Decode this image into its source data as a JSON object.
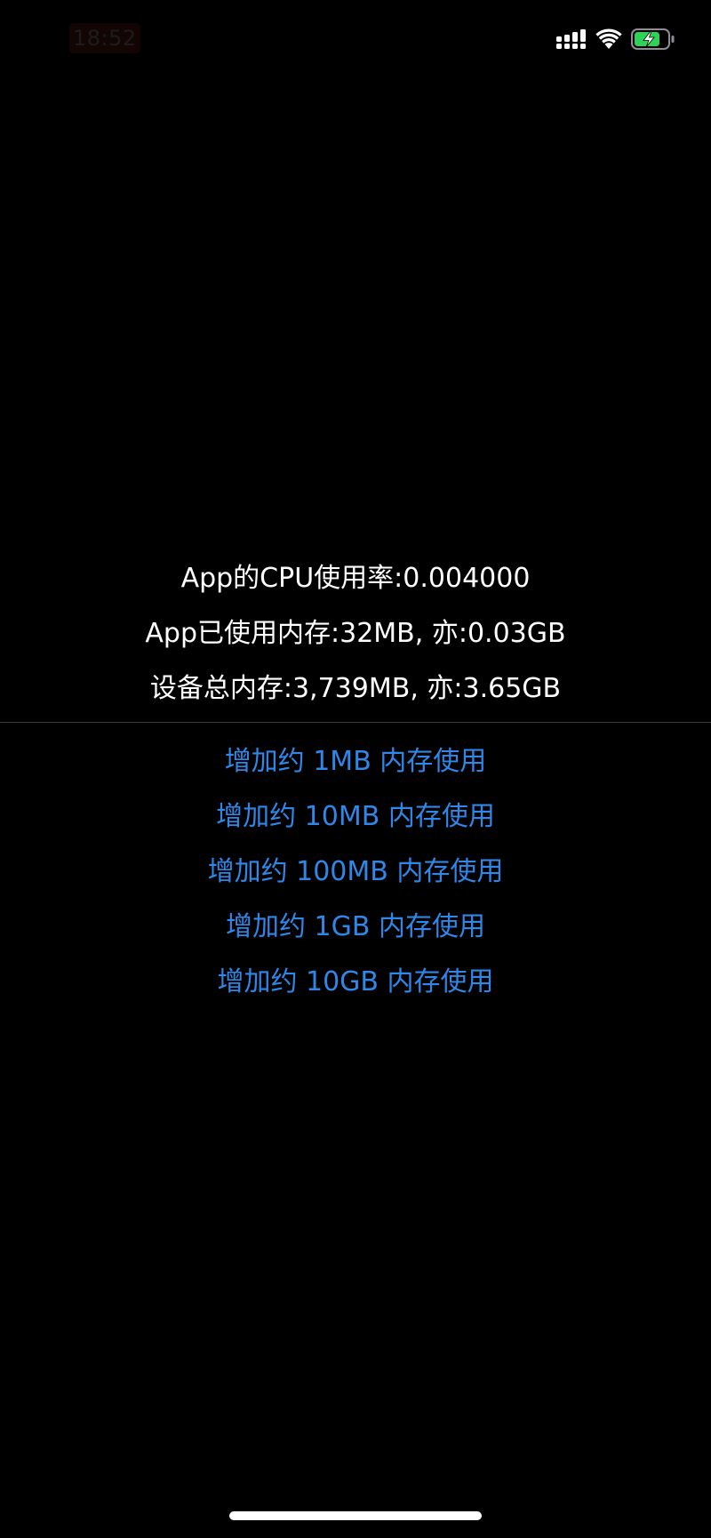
{
  "status_bar": {
    "time": "18:52",
    "signal_icon": "cellular-signal-icon",
    "wifi_icon": "wifi-icon",
    "battery_icon": "battery-charging-icon",
    "battery_color": "#30d158"
  },
  "stats": {
    "cpu_usage": "App的CPU使用率:0.004000",
    "app_memory": "App已使用内存:32MB, 亦:0.03GB",
    "device_memory": "设备总内存:3,739MB, 亦:3.65GB"
  },
  "actions": [
    {
      "label": "增加约 1MB 内存使用"
    },
    {
      "label": "增加约 10MB 内存使用"
    },
    {
      "label": "增加约 100MB 内存使用"
    },
    {
      "label": "增加约 1GB 内存使用"
    },
    {
      "label": "增加约 10GB 内存使用"
    }
  ],
  "colors": {
    "background": "#000000",
    "text": "#ffffff",
    "accent": "#2f87e8",
    "divider": "#3a3a3c"
  }
}
